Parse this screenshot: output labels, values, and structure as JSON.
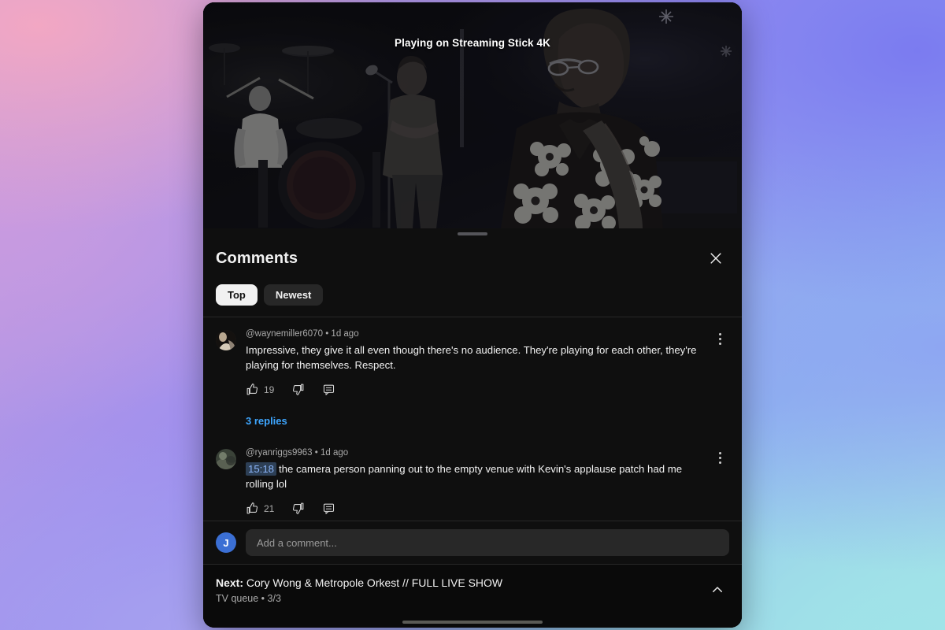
{
  "video": {
    "casting_label": "Playing on Streaming Stick 4K",
    "scene_description": "dark concert stage with guitarist in floral shirt, drummer and singer"
  },
  "sheet": {
    "title": "Comments",
    "close_icon": "close-icon",
    "grabber_icon": "drag-handle",
    "filters": [
      {
        "label": "Top",
        "active": true
      },
      {
        "label": "Newest",
        "active": false
      }
    ]
  },
  "comments": [
    {
      "author": "@waynemiller6070",
      "separator": "•",
      "time": "1d ago",
      "text": "Impressive, they give it all even though there's no audience. They're playing for each other, they're playing for themselves. Respect.",
      "timestamp_link": null,
      "likes": "19",
      "like_icon": "thumbs-up-icon",
      "dislike_icon": "thumbs-down-icon",
      "reply_icon": "reply-icon",
      "menu_icon": "more-vertical-icon",
      "replies_label": "3 replies"
    },
    {
      "author": "@ryanriggs9963",
      "separator": "•",
      "time": "1d ago",
      "text": "the camera person panning out to the empty venue with Kevin's applause patch had me rolling lol",
      "timestamp_link": "15:18",
      "likes": "21",
      "like_icon": "thumbs-up-icon",
      "dislike_icon": "thumbs-down-icon",
      "reply_icon": "reply-icon",
      "menu_icon": "more-vertical-icon",
      "replies_label": null
    }
  ],
  "add_comment": {
    "avatar_initial": "J",
    "placeholder": "Add a comment...",
    "value": ""
  },
  "next_up": {
    "prefix": "Next:",
    "title": "Cory Wong & Metropole Orkest // FULL LIVE SHOW",
    "subtitle": "TV queue • 3/3",
    "chevron_icon": "chevron-up-icon"
  },
  "colors": {
    "sheet_bg": "#0f0f0f",
    "chip_active_bg": "#f1f1f1",
    "chip_bg": "#272727",
    "link_blue": "#3ea6ff",
    "timestamp_blue": "#8ab4f8",
    "timestamp_chip_bg": "#2d3f55",
    "avatar_blue": "#3b6fd4",
    "text_primary": "#f1f1f1",
    "text_secondary": "#aaaaaa"
  }
}
